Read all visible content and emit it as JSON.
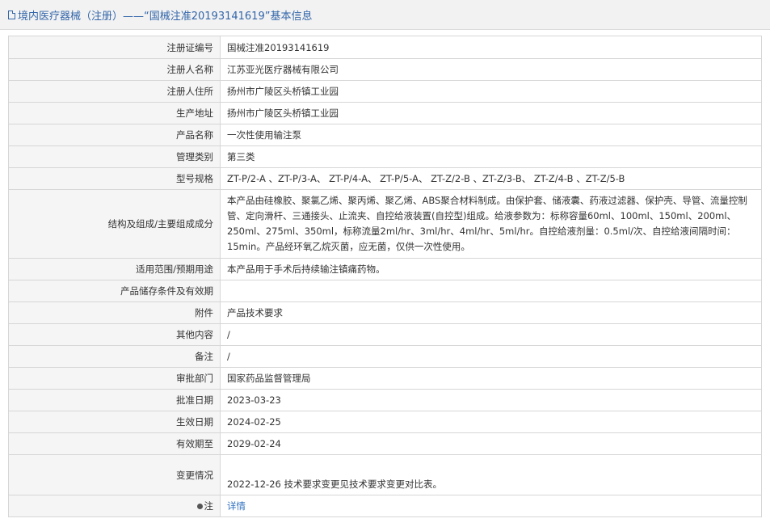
{
  "header": {
    "title": "境内医疗器械（注册）——“国械注准20193141619”基本信息"
  },
  "rows": [
    {
      "label": "注册证编号",
      "value": "国械注准20193141619"
    },
    {
      "label": "注册人名称",
      "value": "江苏亚光医疗器械有限公司"
    },
    {
      "label": "注册人住所",
      "value": "扬州市广陵区头桥镇工业园"
    },
    {
      "label": "生产地址",
      "value": "扬州市广陵区头桥镇工业园"
    },
    {
      "label": "产品名称",
      "value": "一次性使用输注泵"
    },
    {
      "label": "管理类别",
      "value": "第三类"
    },
    {
      "label": "型号规格",
      "value": "ZT-P/2-A 、ZT-P/3-A、 ZT-P/4-A、 ZT-P/5-A、 ZT-Z/2-B 、ZT-Z/3-B、 ZT-Z/4-B 、ZT-Z/5-B"
    },
    {
      "label": "结构及组成/主要组成成分",
      "value": "本产品由硅橡胶、聚氯乙烯、聚丙烯、聚乙烯、ABS聚合材料制成。由保护套、储液囊、药液过滤器、保护壳、导管、流量控制管、定向滑杆、三通接头、止流夹、自控给液装置(自控型)组成。给液参数为：标称容量60ml、100ml、150ml、200ml、250ml、275ml、350ml，标称流量2ml/hr、3ml/hr、4ml/hr、5ml/hr。自控给液剂量：0.5ml/次、自控给液间隔时间：15min。产品经环氧乙烷灭菌，应无菌，仅供一次性使用。"
    },
    {
      "label": "适用范围/预期用途",
      "value": "本产品用于手术后持续输注镇痛药物。"
    },
    {
      "label": "产品储存条件及有效期",
      "value": ""
    },
    {
      "label": "附件",
      "value": "产品技术要求"
    },
    {
      "label": "其他内容",
      "value": "/"
    },
    {
      "label": "备注",
      "value": "/"
    },
    {
      "label": "审批部门",
      "value": "国家药品监督管理局"
    },
    {
      "label": "批准日期",
      "value": "2023-03-23"
    },
    {
      "label": "生效日期",
      "value": "2024-02-25"
    },
    {
      "label": "有效期至",
      "value": "2029-02-24"
    },
    {
      "label": "变更情况",
      "value": "2022-12-26 技术要求变更见技术要求变更对比表。"
    }
  ],
  "note": {
    "label": "注",
    "link": "详情"
  }
}
